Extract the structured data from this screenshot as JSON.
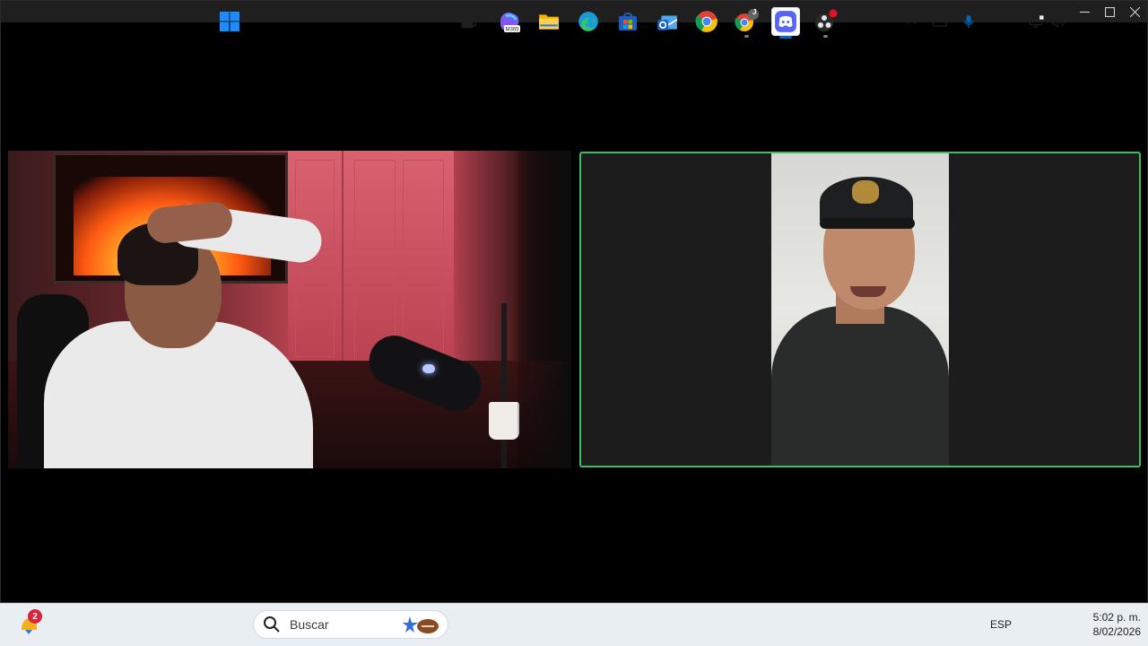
{
  "window": {
    "controls": {
      "minimize": "—",
      "maximize": "☐",
      "close": "✕"
    }
  },
  "call": {
    "participants": [
      {
        "position": "left",
        "active_speaker": false
      },
      {
        "position": "right",
        "active_speaker": true,
        "highlight_color": "#3bbf62"
      }
    ]
  },
  "taskbar": {
    "widgets_badge": "2",
    "search_placeholder": "Buscar",
    "apps": [
      {
        "name": "start",
        "icon": "windows-logo-icon"
      },
      {
        "name": "task-view",
        "icon": "task-view-icon"
      },
      {
        "name": "copilot-m365",
        "icon": "m365-copilot-icon",
        "label": "M365"
      },
      {
        "name": "file-explorer",
        "icon": "folder-icon"
      },
      {
        "name": "edge",
        "icon": "edge-icon"
      },
      {
        "name": "store",
        "icon": "store-icon"
      },
      {
        "name": "outlook",
        "icon": "outlook-icon"
      },
      {
        "name": "chrome",
        "icon": "chrome-icon"
      },
      {
        "name": "chrome-profile",
        "icon": "chrome-profile-icon",
        "profile_letter": "J"
      },
      {
        "name": "discord",
        "icon": "discord-icon",
        "active": true
      },
      {
        "name": "obs",
        "icon": "obs-icon"
      }
    ],
    "tray": {
      "language": "ESP",
      "time": "5:02 p. m.",
      "date": "8/02/2026"
    },
    "accent": "#0067c0"
  }
}
